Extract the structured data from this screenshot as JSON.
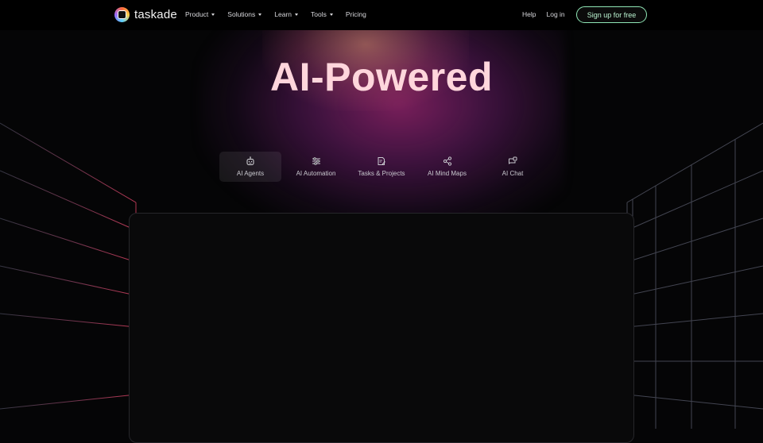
{
  "nav": {
    "logo_text": "taskade",
    "menu": [
      {
        "label": "Product",
        "has_dropdown": true
      },
      {
        "label": "Solutions",
        "has_dropdown": true
      },
      {
        "label": "Learn",
        "has_dropdown": true
      },
      {
        "label": "Tools",
        "has_dropdown": true
      },
      {
        "label": "Pricing",
        "has_dropdown": false
      }
    ],
    "help": "Help",
    "login": "Log in",
    "signup": "Sign up for free"
  },
  "hero": {
    "headline": "AI-Powered"
  },
  "tabs": [
    {
      "label": "AI Agents",
      "icon": "robot-icon",
      "active": true
    },
    {
      "label": "AI Automation",
      "icon": "sliders-icon",
      "active": false
    },
    {
      "label": "Tasks & Projects",
      "icon": "document-edit-icon",
      "active": false
    },
    {
      "label": "AI Mind Maps",
      "icon": "share-nodes-icon",
      "active": false
    },
    {
      "label": "AI Chat",
      "icon": "chat-icon",
      "active": false
    }
  ],
  "colors": {
    "background": "#050506",
    "headline": "#ffd6dc",
    "signup_border": "#8fe6b5",
    "glow": "#a02878"
  }
}
